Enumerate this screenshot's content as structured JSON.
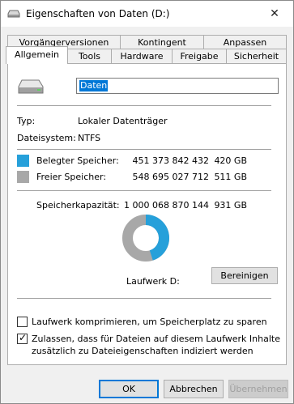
{
  "window": {
    "title": "Eigenschaften von Daten (D:)"
  },
  "tabs_top": [
    "Vorgängerversionen",
    "Kontingent",
    "Anpassen"
  ],
  "tabs_bottom": [
    "Allgemein",
    "Tools",
    "Hardware",
    "Freigabe",
    "Sicherheit"
  ],
  "icons": {
    "title": "drive-icon",
    "drive": "hard-drive-icon",
    "close": "close-icon",
    "check": "checkmark-icon"
  },
  "general": {
    "name_value": "Daten",
    "type_label": "Typ:",
    "type_value": "Lokaler Datenträger",
    "fs_label": "Dateisystem:",
    "fs_value": "NTFS",
    "used_label": "Belegter Speicher:",
    "used_bytes": "451 373 842 432",
    "used_gb": "420 GB",
    "free_label": "Freier Speicher:",
    "free_bytes": "548 695 027 712",
    "free_gb": "511 GB",
    "capacity_label": "Speicherkapazität:",
    "capacity_bytes": "1 000 068 870 144",
    "capacity_gb": "931 GB",
    "drive_label": "Laufwerk D:",
    "cleanup_button": "Bereinigen",
    "compress_label": "Laufwerk komprimieren, um Speicherplatz zu sparen",
    "compress_checked": false,
    "index_label_line1": "Zulassen, dass für Dateien auf diesem Laufwerk Inhalte",
    "index_label_line2": "zusätzlich zu Dateieigenschaften indiziert werden",
    "index_checked": true
  },
  "usage": {
    "used_fraction": 0.4513,
    "used_color": "#26a0da",
    "free_color": "#a8a8a8"
  },
  "buttons": {
    "ok": "OK",
    "cancel": "Abbrechen",
    "apply": "Übernehmen"
  }
}
